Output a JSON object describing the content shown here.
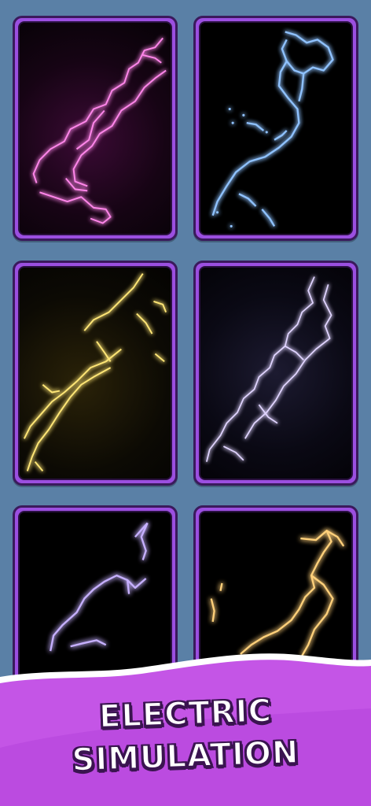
{
  "cards": [
    {
      "id": "pink",
      "color": "#ff7ae6",
      "glow": "#c93cc9",
      "bg": "radial-gradient(circle at 45% 55%, #3a0a34 0%, #160414 55%, #060206 100%)"
    },
    {
      "id": "blue",
      "color": "#6fb0ff",
      "glow": "#2f56ff",
      "bg": "#000000"
    },
    {
      "id": "yellow",
      "color": "#ffe66a",
      "glow": "#f2a900",
      "bg": "radial-gradient(circle at 40% 55%, #2a2208 0%, #0c0a04 60%, #040302 100%)"
    },
    {
      "id": "lavender",
      "color": "#d8c8ff",
      "glow": "#8a6cff",
      "bg": "radial-gradient(circle at 50% 50%, #1c1a30 0%, #0a0914 60%, #040308 100%)"
    },
    {
      "id": "violet",
      "color": "#b69bff",
      "glow": "#6a2cff",
      "bg": "#000000"
    },
    {
      "id": "orange",
      "color": "#ffd27a",
      "glow": "#ff8a00",
      "bg": "#000000"
    }
  ],
  "banner": {
    "line1": "ELECTRIC",
    "line2": "SIMULATION",
    "color": "#c455e6"
  }
}
